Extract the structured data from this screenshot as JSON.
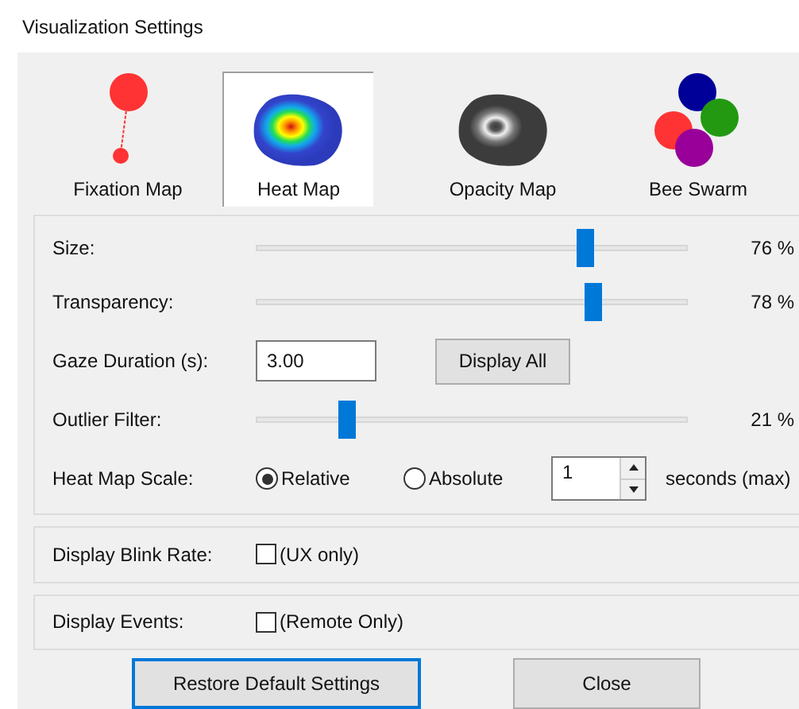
{
  "window": {
    "title": "Visualization Settings"
  },
  "modes": [
    {
      "kind": "fixation",
      "label": "Fixation Map",
      "selected": false
    },
    {
      "kind": "heat",
      "label": "Heat Map",
      "selected": true
    },
    {
      "kind": "opacity",
      "label": "Opacity Map",
      "selected": false
    },
    {
      "kind": "swarm",
      "label": "Bee Swarm",
      "selected": false
    }
  ],
  "settings": [
    {
      "kind": "slider",
      "label": "Size:",
      "level": 0.76,
      "reading": "76 %"
    },
    {
      "kind": "slider",
      "label": "Transparency:",
      "level": 0.78,
      "reading": "78 %"
    },
    {
      "kind": "field",
      "label": "Gaze Duration (s):",
      "value": "3.00",
      "button": "Display All"
    },
    {
      "kind": "slider",
      "label": "Outlier Filter:",
      "level": 0.21,
      "reading": "21 %"
    },
    {
      "kind": "scale",
      "label": "Heat Map Scale:",
      "options": [
        {
          "label": "Relative",
          "selected": true
        },
        {
          "label": "Absolute",
          "selected": false
        }
      ],
      "value": "1",
      "unit": "seconds (max)"
    }
  ],
  "toggles": [
    {
      "label": "Display Blink Rate:",
      "text": "(UX only)",
      "checked": false
    },
    {
      "label": "Display Events:",
      "text": "(Remote Only)",
      "checked": false
    }
  ],
  "buttons": [
    {
      "label": "Restore Default Settings",
      "default": true
    },
    {
      "label": "Close",
      "default": false
    }
  ]
}
